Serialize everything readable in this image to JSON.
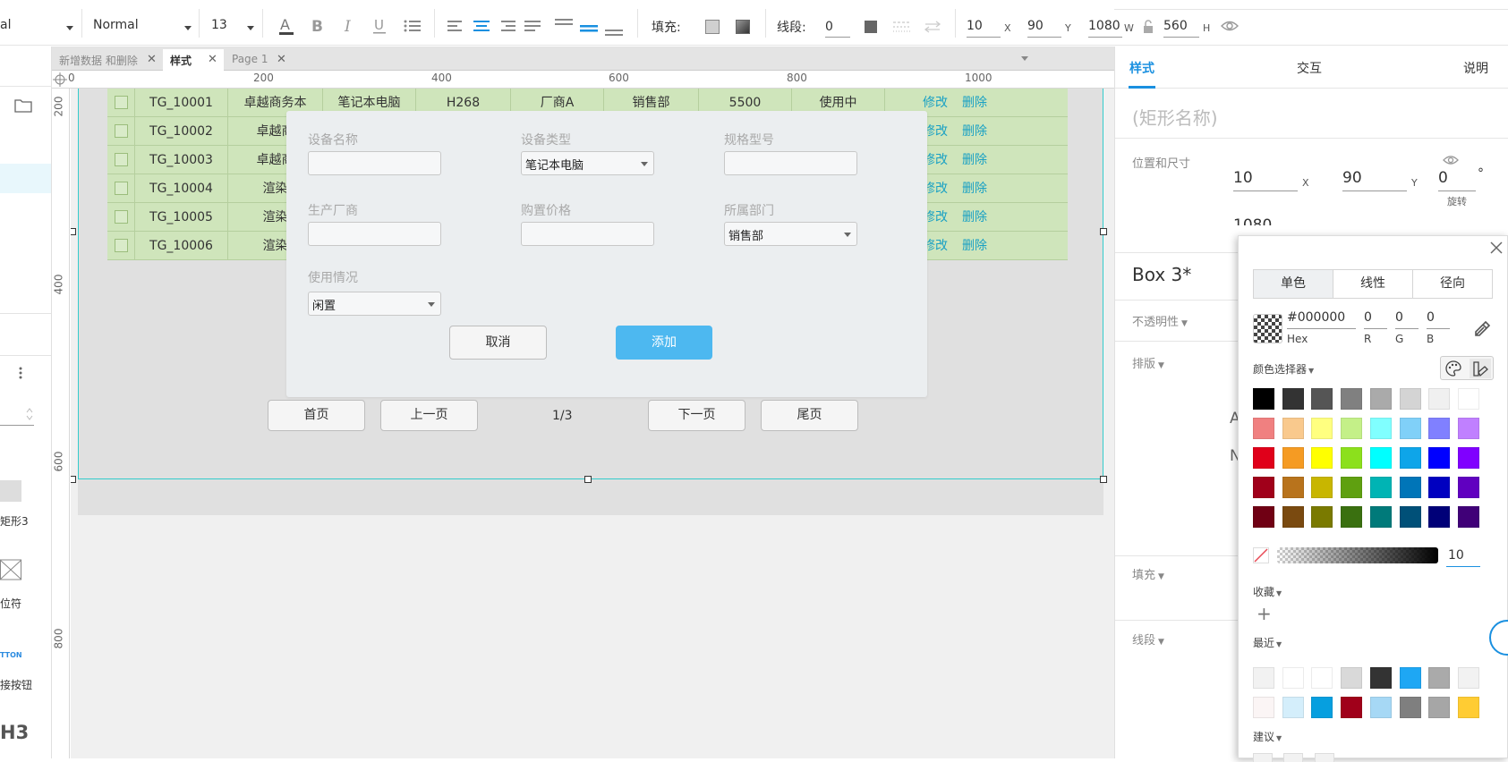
{
  "toolbar": {
    "font_family_partial": "al",
    "font_style": "Normal",
    "font_size": "13",
    "fill_label": "填充:",
    "stroke_label": "线段:",
    "stroke_value": "0",
    "x_value": "10",
    "x_label": "X",
    "y_value": "90",
    "y_label": "Y",
    "w_value": "1080",
    "w_label": "W",
    "h_value": "560",
    "h_label": "H"
  },
  "tabs": [
    {
      "label": "新增数据 和删除"
    },
    {
      "label": "样式"
    },
    {
      "label": "Page 1"
    }
  ],
  "ruler": {
    "top": [
      "0",
      "200",
      "400",
      "600",
      "800",
      "1000"
    ],
    "left": [
      "200",
      "400",
      "600",
      "800"
    ]
  },
  "left_panel": {
    "label_a": "矩形3",
    "label_b": "位符",
    "label_c": "TTON",
    "label_d": "接按钮",
    "label_e": "H3"
  },
  "table": {
    "rows": [
      {
        "id": "TG_10001",
        "name": "卓越商务本",
        "type": "笔记本电脑",
        "model": "H268",
        "maker": "厂商A",
        "dept": "销售部",
        "price": "5500",
        "status": "使用中"
      },
      {
        "id": "TG_10002",
        "name": "卓越商"
      },
      {
        "id": "TG_10003",
        "name": "卓越商"
      },
      {
        "id": "TG_10004",
        "name": "渲染"
      },
      {
        "id": "TG_10005",
        "name": "渲染"
      },
      {
        "id": "TG_10006",
        "name": "渲染"
      }
    ],
    "edit_label": "修改",
    "delete_label": "删除"
  },
  "dialog": {
    "fields": [
      {
        "label": "设备名称",
        "value": ""
      },
      {
        "label": "设备类型",
        "value": "笔记本电脑"
      },
      {
        "label": "规格型号",
        "value": ""
      },
      {
        "label": "生产厂商",
        "value": ""
      },
      {
        "label": "购置价格",
        "value": ""
      },
      {
        "label": "所属部门",
        "value": "销售部"
      },
      {
        "label": "使用情况",
        "value": "闲置"
      }
    ],
    "cancel_label": "取消",
    "add_label": "添加"
  },
  "pagination": {
    "first": "首页",
    "prev": "上一页",
    "indicator": "1/3",
    "next": "下一页",
    "last": "尾页"
  },
  "right_panel": {
    "tabs": [
      "样式",
      "交互",
      "说明"
    ],
    "name_placeholder": "(矩形名称)",
    "pos_size_label": "位置和尺寸",
    "x_value": "10",
    "x_label": "X",
    "y_value": "90",
    "y_label": "Y",
    "rotate_value": "0",
    "rotate_unit": "°",
    "rotate_label": "旋转",
    "partial_row": "1080",
    "style_name": "Box 3*",
    "opacity_label": "不透明性",
    "layout_label": "排版",
    "fill_label": "填充",
    "stroke_label": "线段"
  },
  "color_picker": {
    "tabs": [
      "单色",
      "线性",
      "径向"
    ],
    "hex": "#000000",
    "hex_label": "Hex",
    "r": "0",
    "g": "0",
    "b": "0",
    "r_label": "R",
    "g_label": "G",
    "b_label": "B",
    "selector_label": "颜色选择器",
    "opacity_value": "10",
    "favorites_label": "收藏",
    "recent_label": "最近",
    "suggest_label": "建议",
    "palette": [
      [
        "#000000",
        "#333333",
        "#555555",
        "#808080",
        "#aaaaaa",
        "#d4d4d4",
        "#f0f0f0",
        "#ffffff"
      ],
      [
        "#f08080",
        "#f9c98d",
        "#ffff80",
        "#c4f088",
        "#80ffff",
        "#80d0f8",
        "#8080ff",
        "#c080ff"
      ],
      [
        "#e0001a",
        "#f59b23",
        "#ffff00",
        "#8ce01c",
        "#00ffff",
        "#0ea5e9",
        "#0000ff",
        "#8000ff"
      ],
      [
        "#a0001a",
        "#b8731c",
        "#c8b600",
        "#5fa010",
        "#00b4b4",
        "#0075b8",
        "#0000c0",
        "#6000c0"
      ],
      [
        "#700014",
        "#7a4a10",
        "#7a7a00",
        "#3a7010",
        "#007a7a",
        "#005078",
        "#000078",
        "#400078"
      ]
    ],
    "recent": [
      [
        "#f2f2f2",
        "#ffffff",
        "#ffffff",
        "#d9d9d9",
        "#333333",
        "#1ea7f4",
        "#aaaaaa",
        "#f2f2f2"
      ],
      [
        "#fbf5f5",
        "#d4eefb",
        "#069fdf",
        "#a0001a",
        "#a6d8f5",
        "#7f7f7f",
        "#a6a6a6",
        "#ffcc33"
      ]
    ]
  }
}
